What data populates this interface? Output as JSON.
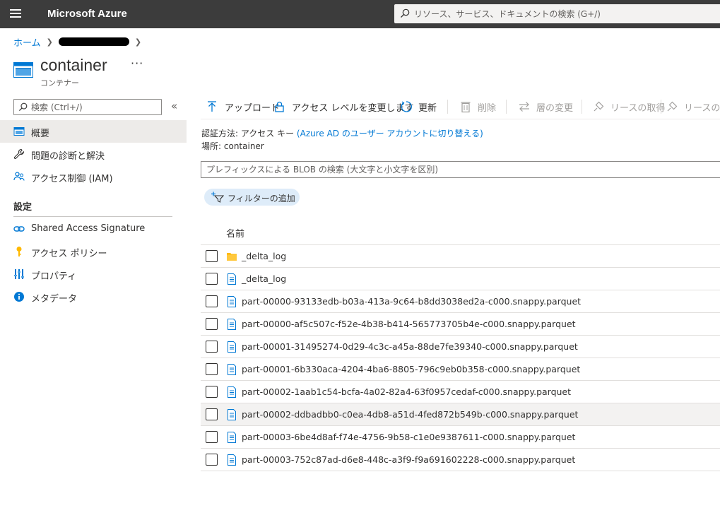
{
  "topbar": {
    "brand": "Microsoft Azure",
    "search_placeholder": "リソース、サービス、ドキュメントの検索 (G+/)"
  },
  "breadcrumb": {
    "home": "ホーム"
  },
  "header": {
    "title": "container",
    "subtitle": "コンテナー",
    "more": "···"
  },
  "sidebar": {
    "search_placeholder": "検索 (Ctrl+/)",
    "collapse": "«",
    "items": [
      {
        "label": "概要",
        "icon": "overview-icon",
        "active": true
      },
      {
        "label": "問題の診断と解決",
        "icon": "wrench-icon"
      },
      {
        "label": "アクセス制御 (IAM)",
        "icon": "people-icon"
      }
    ],
    "section_label": "設定",
    "settings": [
      {
        "label": "Shared Access Signature",
        "icon": "link-icon"
      },
      {
        "label": "アクセス ポリシー",
        "icon": "key-icon"
      },
      {
        "label": "プロパティ",
        "icon": "properties-icon"
      },
      {
        "label": "メタデータ",
        "icon": "info-icon"
      }
    ]
  },
  "commandbar": {
    "upload": "アップロード",
    "access_level": "アクセス レベルを変更します",
    "refresh": "更新",
    "delete": "削除",
    "change_tier": "層の変更",
    "acquire_lease": "リースの取得",
    "break_lease": "リースの解"
  },
  "info": {
    "auth_label": "認証方法:",
    "auth_value": "アクセス キー",
    "auth_link": "(Azure AD のユーザー アカウントに切り替える)",
    "location_label": "場所:",
    "location_value": "container"
  },
  "blob_search": {
    "placeholder": "プレフィックスによる BLOB の検索 (大文字と小文字を区別)"
  },
  "filter": {
    "label": "フィルターの追加"
  },
  "table": {
    "column_name": "名前",
    "rows": [
      {
        "name": "_delta_log",
        "type": "folder"
      },
      {
        "name": "_delta_log",
        "type": "file"
      },
      {
        "name": "part-00000-93133edb-b03a-413a-9c64-b8dd3038ed2a-c000.snappy.parquet",
        "type": "file"
      },
      {
        "name": "part-00000-af5c507c-f52e-4b38-b414-565773705b4e-c000.snappy.parquet",
        "type": "file"
      },
      {
        "name": "part-00001-31495274-0d29-4c3c-a45a-88de7fe39340-c000.snappy.parquet",
        "type": "file"
      },
      {
        "name": "part-00001-6b330aca-4204-4ba6-8805-796c9eb0b358-c000.snappy.parquet",
        "type": "file"
      },
      {
        "name": "part-00002-1aab1c54-bcfa-4a02-82a4-63f0957cedaf-c000.snappy.parquet",
        "type": "file"
      },
      {
        "name": "part-00002-ddbadbb0-c0ea-4db8-a51d-4fed872b549b-c000.snappy.parquet",
        "type": "file"
      },
      {
        "name": "part-00003-6be4d8af-f74e-4756-9b58-c1e0e9387611-c000.snappy.parquet",
        "type": "file"
      },
      {
        "name": "part-00003-752c87ad-d6e8-448c-a3f9-f9a691602228-c000.snappy.parquet",
        "type": "file"
      }
    ]
  },
  "colors": {
    "topbar": "#3c3c3c",
    "accent": "#0078d4",
    "folder": "#ffb900",
    "active_nav": "#edebe9"
  }
}
